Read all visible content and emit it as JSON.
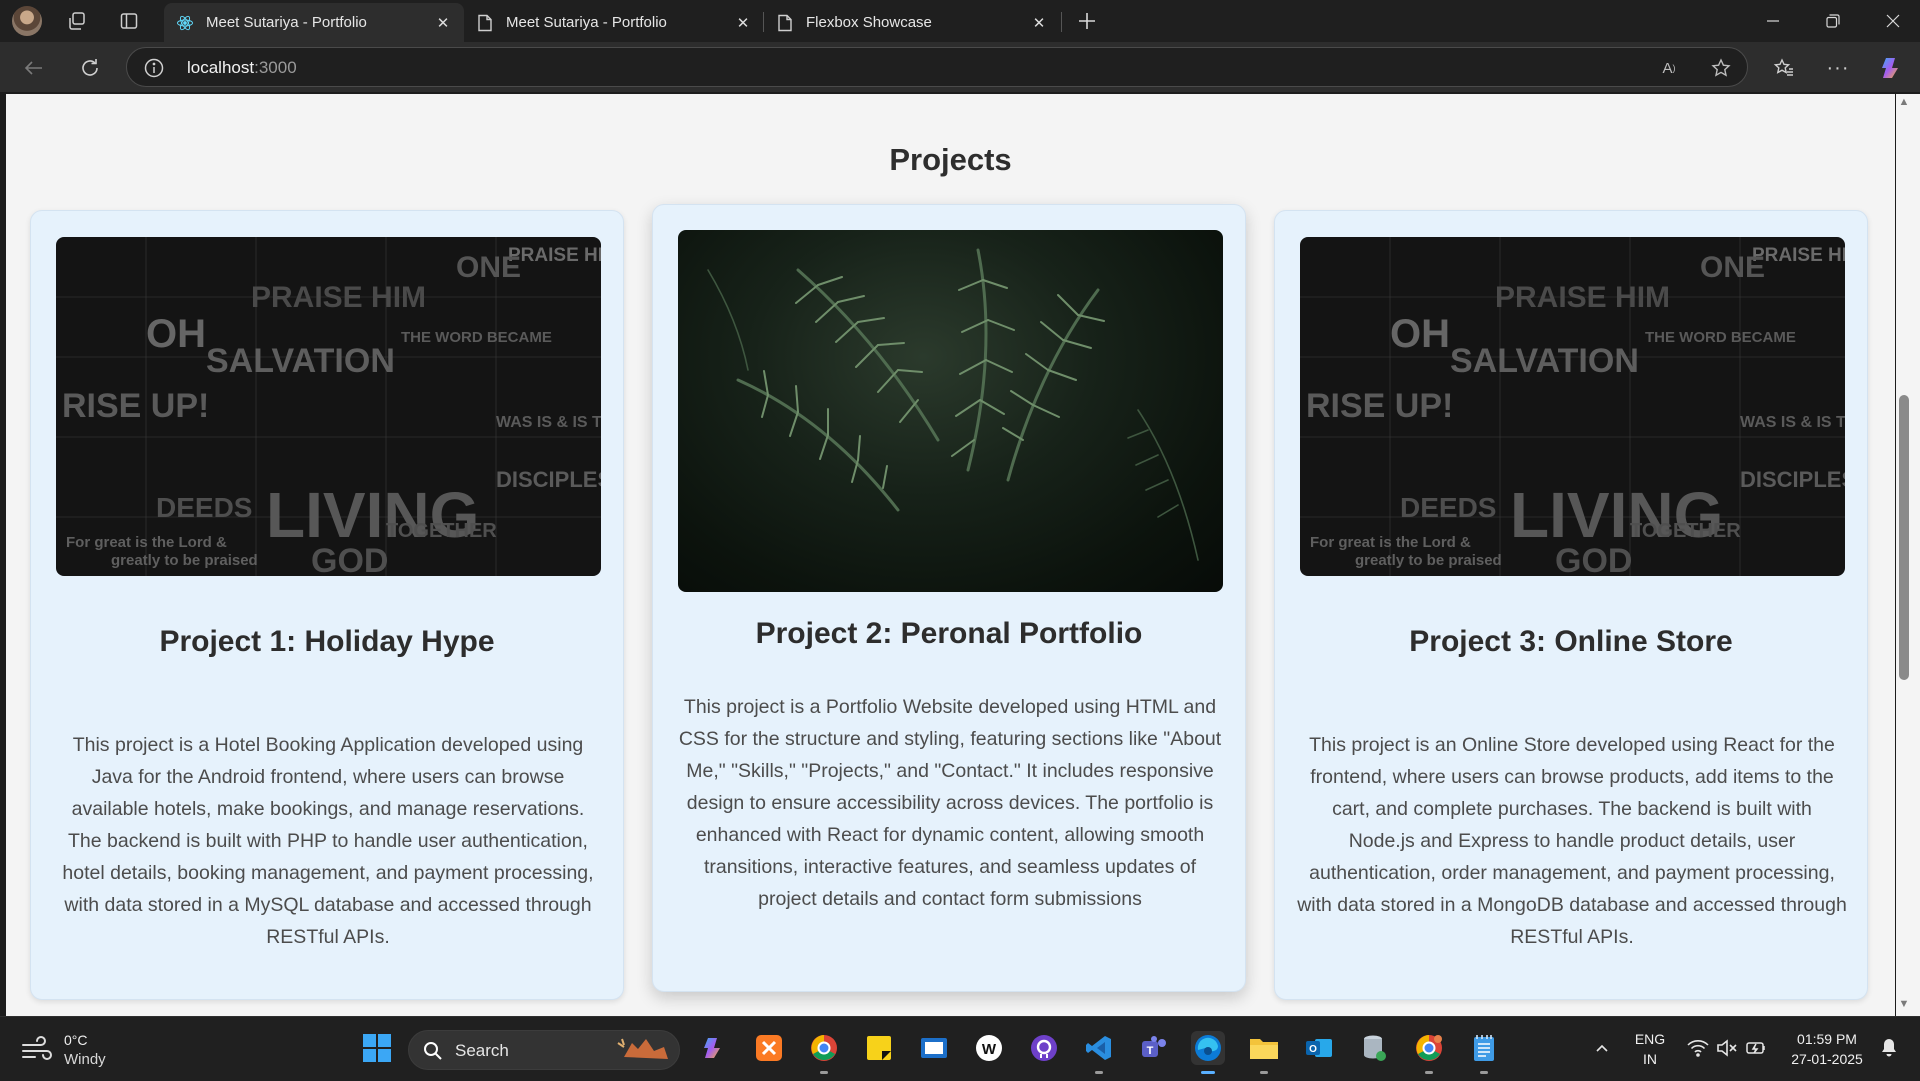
{
  "browser": {
    "tabs": [
      {
        "title": "Meet Sutariya - Portfolio",
        "active": true,
        "icon": "react-icon"
      },
      {
        "title": "Meet Sutariya - Portfolio",
        "active": false,
        "icon": "page-icon"
      },
      {
        "title": "Flexbox Showcase",
        "active": false,
        "icon": "page-icon"
      }
    ],
    "url_host": "localhost",
    "url_port": ":3000"
  },
  "page": {
    "section_title": "Projects",
    "projects": [
      {
        "title": "Project 1: Holiday Hype",
        "description": "This project is a Hotel Booking Application developed using Java for the Android frontend, where users can browse available hotels, make bookings, and manage reservations. The backend is built with PHP to handle user authentication, hotel details, booking management, and payment processing, with data stored in a MySQL database and accessed through RESTful APIs.",
        "image": "typography-collage-image"
      },
      {
        "title": "Project 2: Peronal Portfolio",
        "description": "This project is a Portfolio Website developed using HTML and CSS for the structure and styling, featuring sections like \"About Me,\" \"Skills,\" \"Projects,\" and \"Contact.\" It includes responsive design to ensure accessibility across devices. The portfolio is enhanced with React for dynamic content, allowing smooth transitions, interactive features, and seamless updates of project details and contact form submissions",
        "image": "fern-leaves-image"
      },
      {
        "title": "Project 3: Online Store",
        "description": "This project is an Online Store developed using React for the frontend, where users can browse products, add items to the cart, and complete purchases. The backend is built with Node.js and Express to handle product details, user authentication, order management, and payment processing, with data stored in a MongoDB database and accessed through RESTful APIs.",
        "image": "typography-collage-image"
      }
    ],
    "image_words": {
      "praise": "PRAISE HIM",
      "oh": "OH",
      "salvation": "SALVATION",
      "living": "LIVING",
      "god": "GOD",
      "rise": "RISE UP!",
      "word": "THE WORD BECAME",
      "disciples": "DISCIPLES",
      "deeds": "DEEDS",
      "together": "TOGETHER",
      "one": "ONE",
      "was": "WAS IS & IS TO COME",
      "great": "For great is the Lord &",
      "praised": "greatly to be praised"
    }
  },
  "taskbar": {
    "weather_temp": "0°C",
    "weather_condition": "Windy",
    "search_placeholder": "Search",
    "language": "ENG",
    "region": "IN",
    "time": "01:59 PM",
    "date": "27-01-2025"
  },
  "colors": {
    "card_bg": "#e6f2fc",
    "page_bg": "#f4f4f4",
    "accent": "#5ab0ff"
  }
}
